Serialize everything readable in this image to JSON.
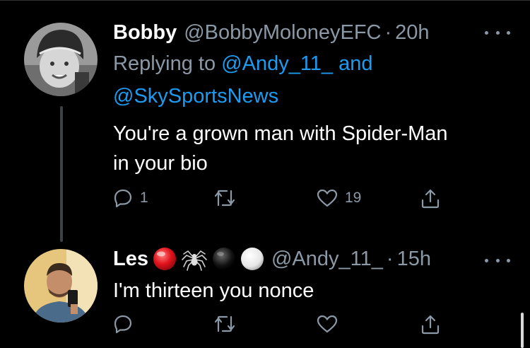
{
  "colors": {
    "background": "#000000",
    "muted": "#8b98a5",
    "link": "#1d9bf0",
    "text": "#ffffff"
  },
  "reply_tweet": {
    "author_name": "Bobby",
    "author_handle": "@BobbyMoloneyEFC",
    "separator": "·",
    "time": "20h",
    "replying_prefix": "Replying to",
    "mention_1": "@Andy_11_",
    "and_word": "and",
    "mention_2": "@SkySportsNews",
    "text_line_1": "You're a grown man with Spider-Man",
    "text_line_2": "in your bio",
    "reply_count": "1",
    "like_count": "19",
    "icons": [
      "avatar",
      "more-icon",
      "reply-icon",
      "retweet-icon",
      "like-icon",
      "share-icon"
    ]
  },
  "response_tweet": {
    "author_name": "Les",
    "name_emojis": [
      "red-circle-emoji",
      "spider-emoji",
      "black-circle-emoji",
      "white-circle-emoji"
    ],
    "author_handle": "@Andy_11_",
    "separator": "·",
    "time": "15h",
    "text": "I'm thirteen you nonce",
    "icons": [
      "avatar",
      "more-icon",
      "reply-icon",
      "retweet-icon",
      "like-icon",
      "share-icon"
    ]
  }
}
